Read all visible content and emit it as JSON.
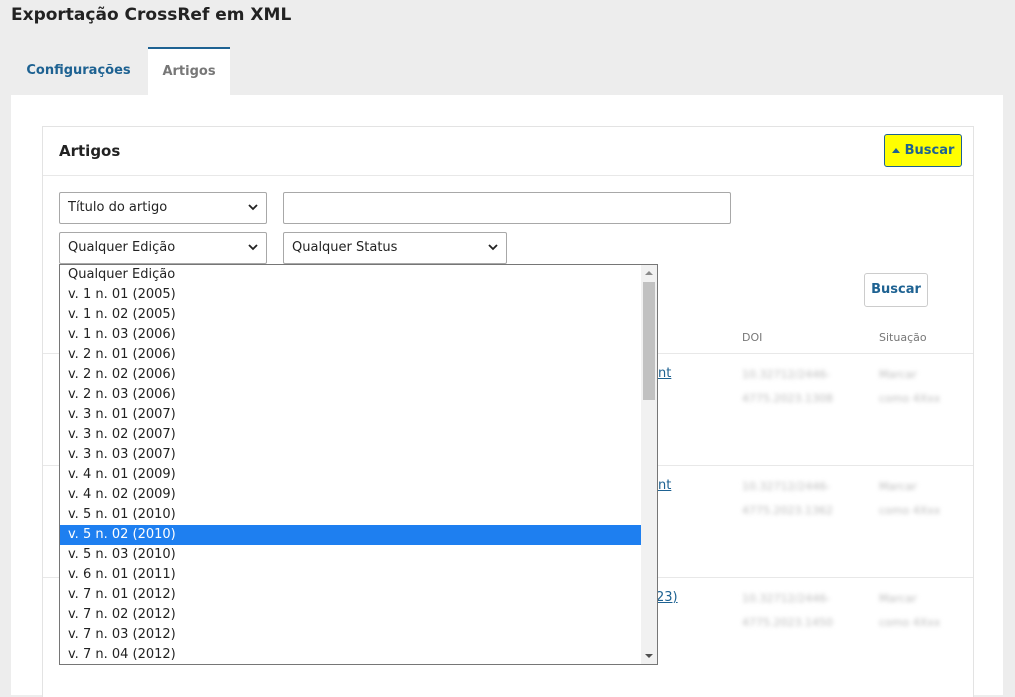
{
  "page": {
    "title": "Exportação CrossRef em XML"
  },
  "tabs": [
    {
      "label": "Configurações",
      "active": false
    },
    {
      "label": "Artigos",
      "active": true
    }
  ],
  "card": {
    "title": "Artigos",
    "toggle_search_label": "Buscar",
    "search_button_label": "Buscar"
  },
  "filters": {
    "field_select": "Título do artigo",
    "search_value": "",
    "issue_select": "Qualquer Edição",
    "status_select": "Qualquer Status"
  },
  "table": {
    "columns": {
      "doi": "DOI",
      "status": "Situação"
    },
    "rows": [
      {
        "link_fragment": "nt",
        "doi": [
          "10.32712/2446-",
          "4775.2023.1308"
        ],
        "status": [
          "Marcar",
          "como 4Xxx"
        ]
      },
      {
        "link_fragment": "nt",
        "doi": [
          "10.32712/2446-",
          "4775.2023.1362"
        ],
        "status": [
          "Marcar",
          "como 4Xxx"
        ]
      },
      {
        "link_fragment": "23)",
        "doi": [
          "10.32712/2446-",
          "4775.2023.1450"
        ],
        "status": [
          "Marcar",
          "como 4Xxx"
        ]
      }
    ]
  },
  "issue_dropdown": {
    "selected_index": 13,
    "options": [
      "Qualquer Edição",
      "v. 1 n. 01 (2005)",
      "v. 1 n. 02 (2005)",
      "v. 1 n. 03 (2006)",
      "v. 2 n. 01 (2006)",
      "v. 2 n. 02 (2006)",
      "v. 2 n. 03 (2006)",
      "v. 3 n. 01 (2007)",
      "v. 3 n. 02 (2007)",
      "v. 3 n. 03 (2007)",
      "v. 4 n. 01 (2009)",
      "v. 4 n. 02 (2009)",
      "v. 5 n. 01 (2010)",
      "v. 5 n. 02 (2010)",
      "v. 5 n. 03 (2010)",
      "v. 6 n. 01 (2011)",
      "v. 7 n. 01 (2012)",
      "v. 7 n. 02 (2012)",
      "v. 7 n. 03 (2012)",
      "v. 7 n. 04 (2012)"
    ]
  },
  "icons": {
    "toggle": "caret-up-icon",
    "select": "chevron-down-icon"
  },
  "colors": {
    "accent": "#1e6292",
    "highlight": "#ffff00",
    "selected": "#1e7ff0"
  }
}
